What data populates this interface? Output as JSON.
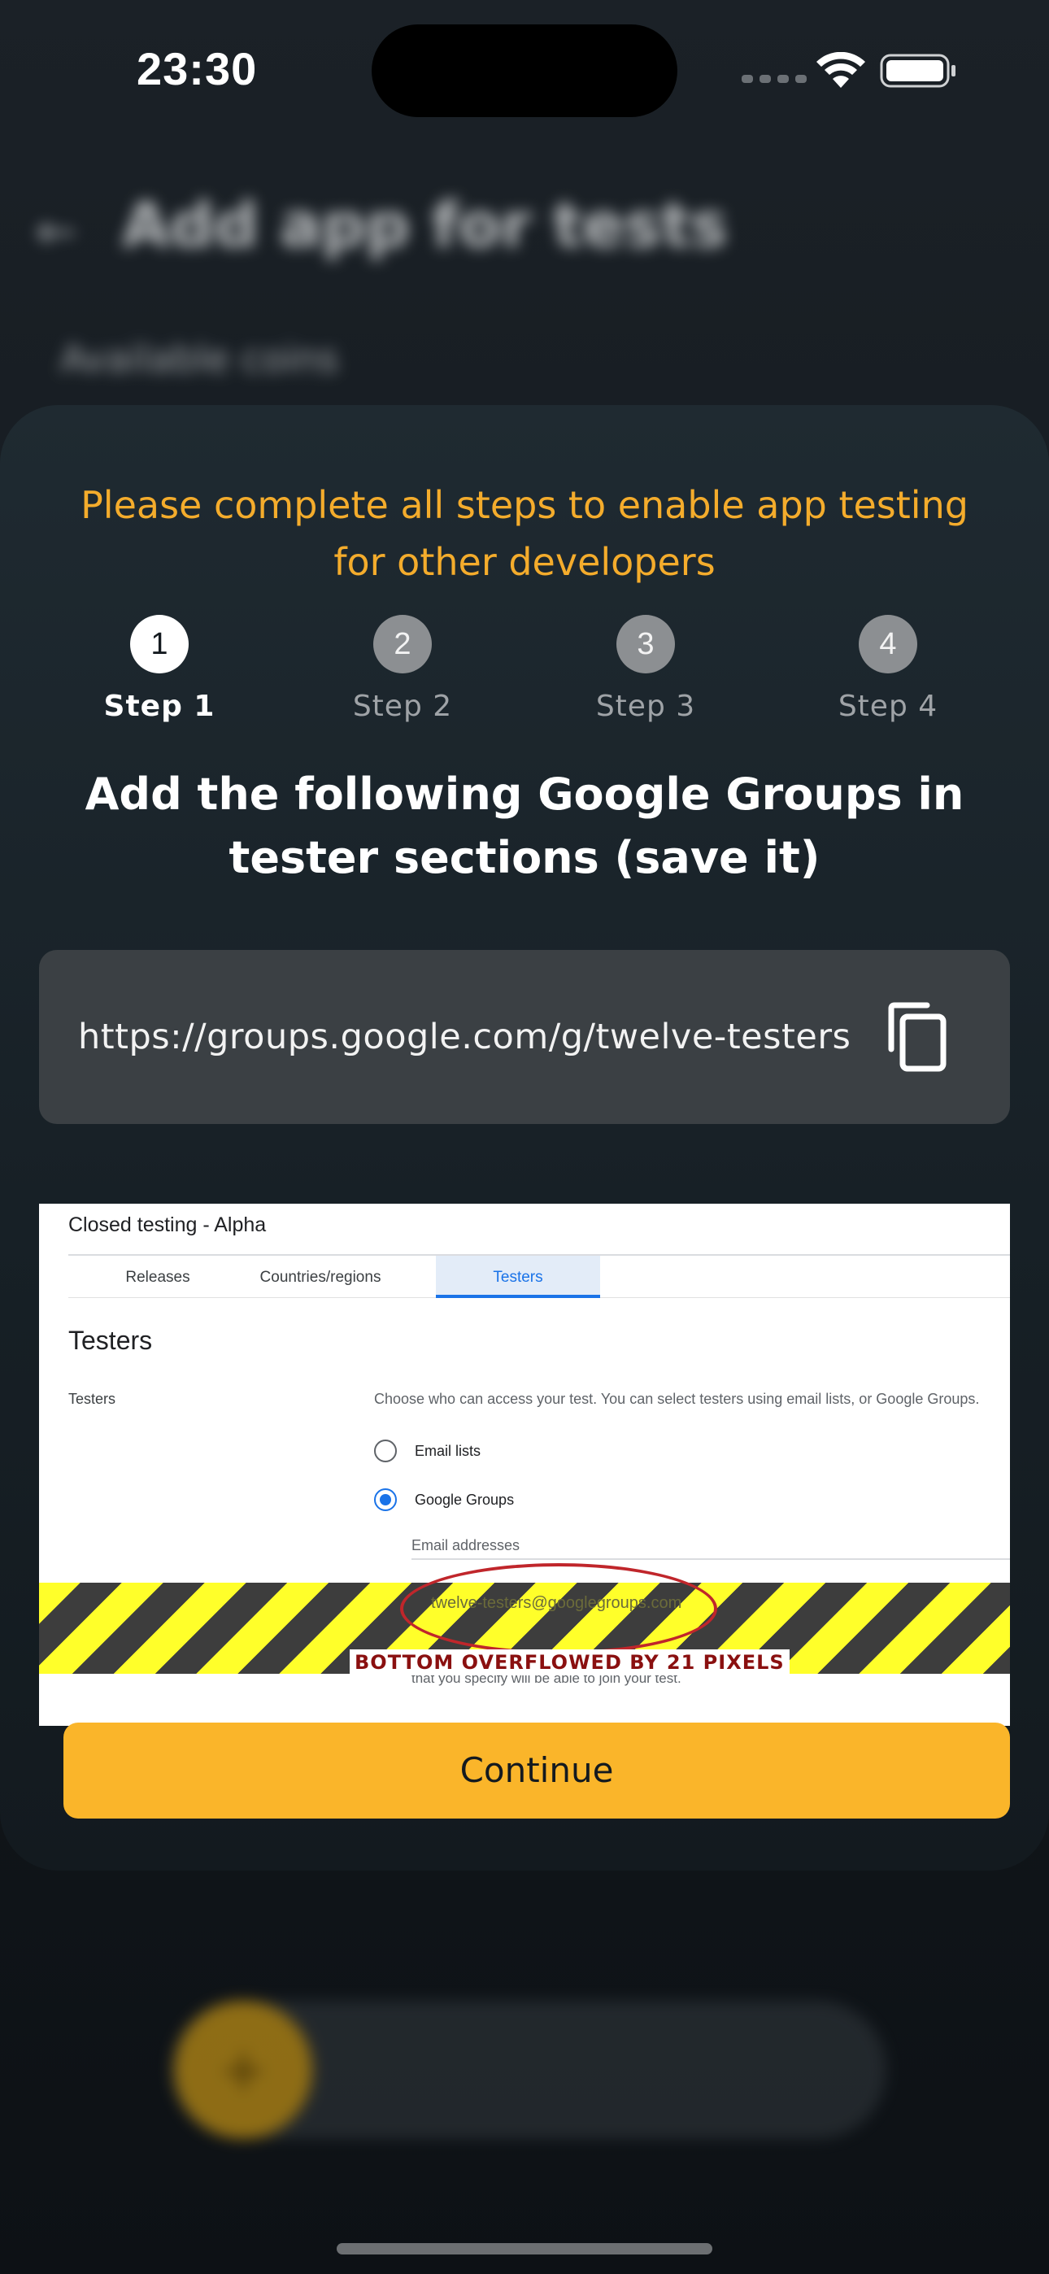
{
  "status_bar": {
    "time": "23:30"
  },
  "background_app": {
    "title": "Add app for tests",
    "subtitle": "Available coins"
  },
  "sheet": {
    "headline": "Please complete all steps to enable app testing for other developers",
    "steps": [
      {
        "number": "1",
        "label": "Step 1",
        "active": true
      },
      {
        "number": "2",
        "label": "Step 2",
        "active": false
      },
      {
        "number": "3",
        "label": "Step 3",
        "active": false
      },
      {
        "number": "4",
        "label": "Step 4",
        "active": false
      }
    ],
    "instruction": "Add the following Google Groups in tester sections (save it)",
    "group_link": "https://groups.google.com/g/twelve-testers",
    "continue_label": "Continue"
  },
  "guide_screenshot": {
    "title": "Closed testing - Alpha",
    "tabs": [
      "Releases",
      "Countries/regions",
      "Testers"
    ],
    "active_tab": "Testers",
    "heading": "Testers",
    "left_label": "Testers",
    "description": "Choose who can access your test. You can select testers using email lists, or Google Groups.",
    "options": [
      "Email lists",
      "Google Groups"
    ],
    "selected_option": "Google Groups",
    "email_field_label": "Email addresses",
    "group_chip": "twelve-testers@googlegroups.com",
    "hint": "that you specify will be able to join your test."
  },
  "debug_overlay": {
    "overflow_text": "BOTTOM OVERFLOWED BY 21 PIXELS"
  },
  "colors": {
    "accent": "#fab52a",
    "headline": "#f4ac2c",
    "sheet_background": "#1f2a31",
    "link_box": "#3b4044",
    "tab_active": "#1a73e8"
  }
}
